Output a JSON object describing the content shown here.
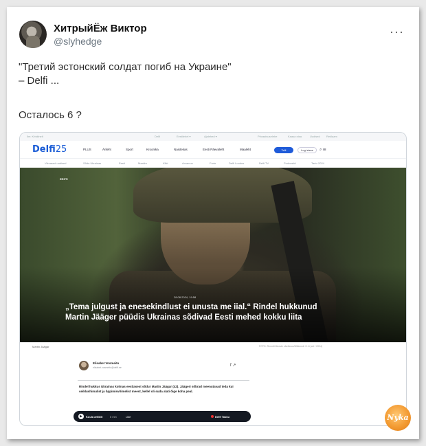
{
  "tweet": {
    "author_name": "ХитрыйЁж Виктор",
    "author_handle": "@slyhedge",
    "more_icon": "more-horizontal-icon",
    "line1": "\"Третий эстонский солдат погиб на Украине\"",
    "line2": "– Delfi ...",
    "line3": "Осталось 6 ?"
  },
  "card": {
    "top_bar": [
      "Ilm: Kristiinelt",
      "Delfi",
      "Eestilehel ▾",
      "Ajalehed ▾",
      "Privaatsuselehe",
      "Kaasa otsa",
      "Uudised",
      "Reklaam"
    ],
    "logo": "Delfi",
    "logo_suffix": "25",
    "nav_items": [
      "PLUS",
      "Ärileht",
      "Sport",
      "Kroonika",
      "Naistekas",
      "Eesti Päevaleht",
      "Maaleht"
    ],
    "tell_button": "Telli",
    "login_button": "Logi sisse",
    "sub_nav": [
      "Viimased uudised",
      "Sõda Ukrainas",
      "Eesti",
      "Maailm",
      "Kliki",
      "Arvamus",
      "Forte",
      "Delfi Loodus",
      "Delfi TV",
      "Podcastid",
      "Tartu 2024"
    ],
    "hero_tag": "EESTI",
    "hero_date": "28.08.2024, 19:58",
    "headline": "„Tema julgust ja enesekindlust ei unusta me iial.“ Rindel hukkunud Martin Jääger püüdis Ukrainas sõdivad Eesti mehed kokku liita",
    "caption_left": "Martin Jäägar",
    "caption_right": "FOTO: Renniti Meeste väeüksus/Wikimedi / 1.6 (cel / 2024)",
    "author": {
      "name": "Elisabet Vosmeitu",
      "email": "elisabet.vosmeitu@delfi.ee"
    },
    "share_icons": "f  ↗",
    "body": "Rindel hukkus Ukrainas kolmas eestlasest sõdur Martin Jäägar (42). Jäägeri sõbrad meenutavad teda kui seiklushimulist ja õppimisvõimelist meest, kellel oli suda alati õige koha peal.",
    "player": {
      "play_icon": "play-icon",
      "listen_label": "Kuula artiklit",
      "duration": "6 min",
      "like_label": "Like",
      "brand_label": "Delfi Tasku"
    }
  },
  "watermark": "Nyka"
}
